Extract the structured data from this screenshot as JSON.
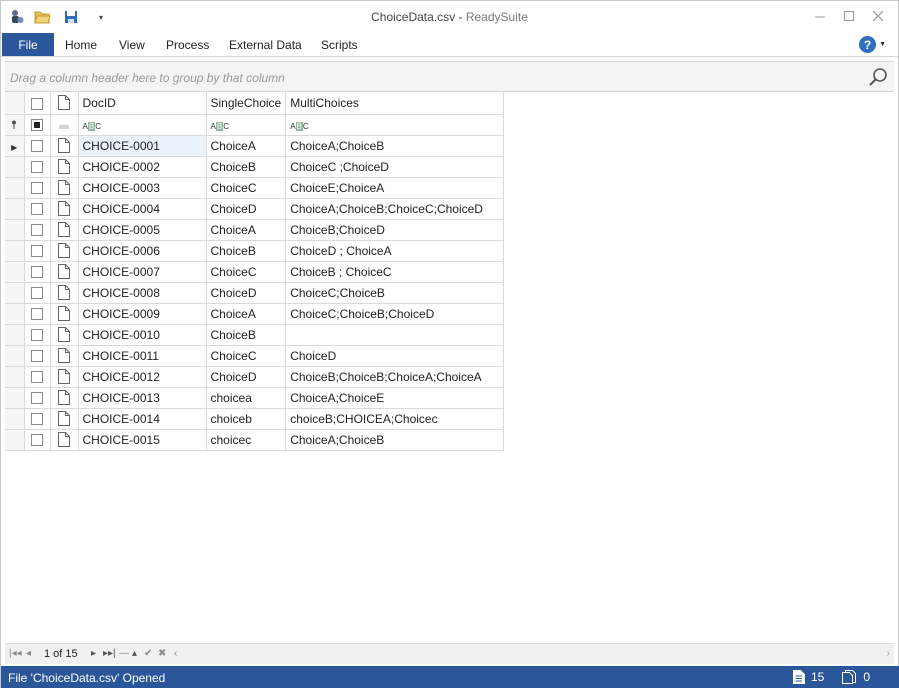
{
  "window": {
    "file_name": "ChoiceData.csv",
    "separator": " - ",
    "app_name": "ReadySuite"
  },
  "ribbon": {
    "file": "File",
    "tabs": [
      "Home",
      "View",
      "Process",
      "External Data",
      "Scripts"
    ]
  },
  "group_panel": {
    "placeholder": "Drag a column header here to group by that column"
  },
  "grid": {
    "columns": [
      "DocID",
      "SingleChoice",
      "MultiChoices"
    ],
    "rows": [
      [
        "CHOICE-0001",
        "ChoiceA",
        "ChoiceA;ChoiceB"
      ],
      [
        "CHOICE-0002",
        "ChoiceB",
        "ChoiceC ;ChoiceD"
      ],
      [
        "CHOICE-0003",
        "ChoiceC",
        "ChoiceE;ChoiceA"
      ],
      [
        "CHOICE-0004",
        "ChoiceD",
        "ChoiceA;ChoiceB;ChoiceC;ChoiceD"
      ],
      [
        "CHOICE-0005",
        "ChoiceA",
        "ChoiceB;ChoiceD"
      ],
      [
        "CHOICE-0006",
        "ChoiceB",
        "ChoiceD ; ChoiceA"
      ],
      [
        "CHOICE-0007",
        "ChoiceC",
        "ChoiceB ; ChoiceC"
      ],
      [
        "CHOICE-0008",
        "ChoiceD",
        "ChoiceC;ChoiceB"
      ],
      [
        "CHOICE-0009",
        "ChoiceA",
        "ChoiceC;ChoiceB;ChoiceD"
      ],
      [
        "CHOICE-0010",
        "ChoiceB",
        ""
      ],
      [
        "CHOICE-0011",
        "ChoiceC",
        "ChoiceD"
      ],
      [
        "CHOICE-0012",
        "ChoiceD",
        "ChoiceB;ChoiceB;ChoiceA;ChoiceA"
      ],
      [
        "CHOICE-0013",
        "choicea",
        "ChoiceA;ChoiceE"
      ],
      [
        "CHOICE-0014",
        "choiceb",
        "choiceB;CHOICEA;Choicec"
      ],
      [
        "CHOICE-0015",
        "choicec",
        "ChoiceA;ChoiceB"
      ]
    ],
    "filter_icon": "abc-text-filter-icon"
  },
  "pager": {
    "position": "1 of 15"
  },
  "status": {
    "message": "File 'ChoiceData.csv' Opened",
    "doc_count": "15",
    "selected_count": "0"
  },
  "colors": {
    "accent": "#2b579a",
    "help": "#2f6fbd",
    "selected_cell": "#eaf3fb"
  }
}
